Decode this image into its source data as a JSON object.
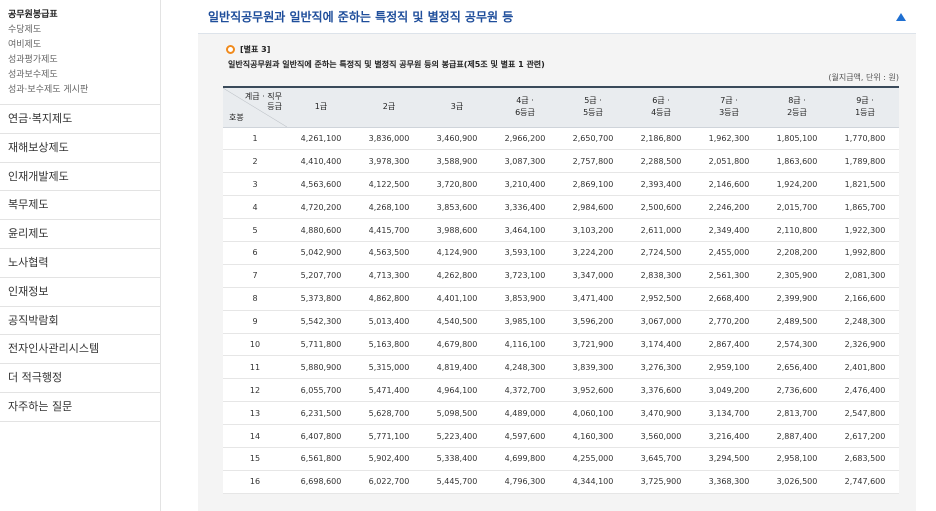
{
  "sidebar": {
    "sub_items": [
      "공무원봉급표",
      "수당제도",
      "여비제도",
      "성과평가제도",
      "성과보수제도",
      "성과·보수제도 게시판"
    ],
    "main_items": [
      "연금·복지제도",
      "재해보상제도",
      "인재개발제도",
      "복무제도",
      "윤리제도",
      "노사협력",
      "인재정보",
      "공직박람회",
      "전자인사관리시스템",
      "더 적극행정",
      "자주하는 질문"
    ]
  },
  "content": {
    "section_title": "일반직공무원과 일반직에 준하는 특정직 및 별정직 공무원 등",
    "table_label": "[별표 3]",
    "table_caption": "일반직공무원과 일반직에 준하는 특정직 및 별정직 공무원 등의 봉급표(제5조 및 별표 1 관련)",
    "unit_note": "(월지급액, 단위 : 원)",
    "corner_top_line1": "계급 · 직무",
    "corner_top_line2": "등급",
    "corner_bottom": "호봉",
    "headers": [
      [
        "1급"
      ],
      [
        "2급"
      ],
      [
        "3급"
      ],
      [
        "4급 ·",
        "6등급"
      ],
      [
        "5급 ·",
        "5등급"
      ],
      [
        "6급 ·",
        "4등급"
      ],
      [
        "7급 ·",
        "3등급"
      ],
      [
        "8급 ·",
        "2등급"
      ],
      [
        "9급 ·",
        "1등급"
      ]
    ],
    "rows": [
      [
        "1",
        "4,261,100",
        "3,836,000",
        "3,460,900",
        "2,966,200",
        "2,650,700",
        "2,186,800",
        "1,962,300",
        "1,805,100",
        "1,770,800"
      ],
      [
        "2",
        "4,410,400",
        "3,978,300",
        "3,588,900",
        "3,087,300",
        "2,757,800",
        "2,288,500",
        "2,051,800",
        "1,863,600",
        "1,789,800"
      ],
      [
        "3",
        "4,563,600",
        "4,122,500",
        "3,720,800",
        "3,210,400",
        "2,869,100",
        "2,393,400",
        "2,146,600",
        "1,924,200",
        "1,821,500"
      ],
      [
        "4",
        "4,720,200",
        "4,268,100",
        "3,853,600",
        "3,336,400",
        "2,984,600",
        "2,500,600",
        "2,246,200",
        "2,015,700",
        "1,865,700"
      ],
      [
        "5",
        "4,880,600",
        "4,415,700",
        "3,988,600",
        "3,464,100",
        "3,103,200",
        "2,611,000",
        "2,349,400",
        "2,110,800",
        "1,922,300"
      ],
      [
        "6",
        "5,042,900",
        "4,563,500",
        "4,124,900",
        "3,593,100",
        "3,224,200",
        "2,724,500",
        "2,455,000",
        "2,208,200",
        "1,992,800"
      ],
      [
        "7",
        "5,207,700",
        "4,713,300",
        "4,262,800",
        "3,723,100",
        "3,347,000",
        "2,838,300",
        "2,561,300",
        "2,305,900",
        "2,081,300"
      ],
      [
        "8",
        "5,373,800",
        "4,862,800",
        "4,401,100",
        "3,853,900",
        "3,471,400",
        "2,952,500",
        "2,668,400",
        "2,399,900",
        "2,166,600"
      ],
      [
        "9",
        "5,542,300",
        "5,013,400",
        "4,540,500",
        "3,985,100",
        "3,596,200",
        "3,067,000",
        "2,770,200",
        "2,489,500",
        "2,248,300"
      ],
      [
        "10",
        "5,711,800",
        "5,163,800",
        "4,679,800",
        "4,116,100",
        "3,721,900",
        "3,174,400",
        "2,867,400",
        "2,574,300",
        "2,326,900"
      ],
      [
        "11",
        "5,880,900",
        "5,315,000",
        "4,819,400",
        "4,248,300",
        "3,839,300",
        "3,276,300",
        "2,959,100",
        "2,656,400",
        "2,401,800"
      ],
      [
        "12",
        "6,055,700",
        "5,471,400",
        "4,964,100",
        "4,372,700",
        "3,952,600",
        "3,376,600",
        "3,049,200",
        "2,736,600",
        "2,476,400"
      ],
      [
        "13",
        "6,231,500",
        "5,628,700",
        "5,098,500",
        "4,489,000",
        "4,060,100",
        "3,470,900",
        "3,134,700",
        "2,813,700",
        "2,547,800"
      ],
      [
        "14",
        "6,407,800",
        "5,771,100",
        "5,223,400",
        "4,597,600",
        "4,160,300",
        "3,560,000",
        "3,216,400",
        "2,887,400",
        "2,617,200"
      ],
      [
        "15",
        "6,561,800",
        "5,902,400",
        "5,338,400",
        "4,699,800",
        "4,255,000",
        "3,645,700",
        "3,294,500",
        "2,958,100",
        "2,683,500"
      ],
      [
        "16",
        "6,698,600",
        "6,022,700",
        "5,445,700",
        "4,796,300",
        "4,344,100",
        "3,725,900",
        "3,368,300",
        "3,026,500",
        "2,747,600"
      ]
    ]
  }
}
